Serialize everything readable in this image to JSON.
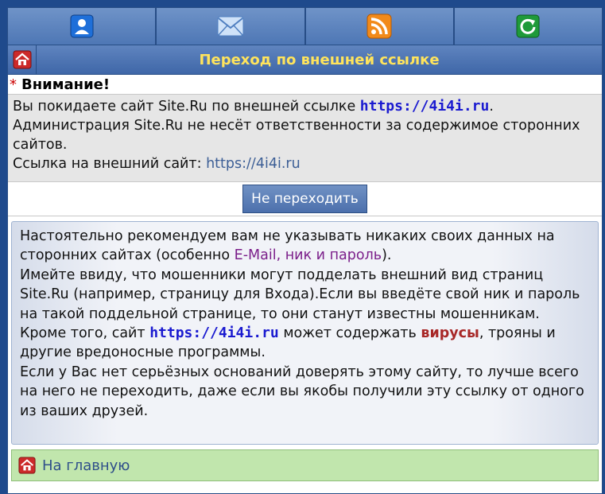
{
  "toolbar": {
    "items": [
      {
        "icon": "user-icon",
        "color": "#1e6fd9"
      },
      {
        "icon": "mail-icon",
        "color": "#9cc3ee"
      },
      {
        "icon": "rss-icon",
        "color": "#f28a1a"
      },
      {
        "icon": "refresh-icon",
        "color": "#1f9a3a"
      }
    ]
  },
  "header": {
    "title": "Переход по внешней ссылке",
    "title_color": "#ffe45c"
  },
  "attention": {
    "star": "*",
    "label": "Внимание!"
  },
  "info": {
    "line1_prefix": "Вы покидаете сайт Site.Ru по внешней ссылке ",
    "link_bold": "https://4i4i.ru",
    "line1_suffix": ".",
    "line2": "Администрация Site.Ru не несёт ответственности за содержимое сторонних сайтов.",
    "line3_prefix": "Ссылка на внешний сайт: ",
    "link_plain": "https://4i4i.ru"
  },
  "stay_button": {
    "label": "Не переходить"
  },
  "warning": {
    "p1_prefix": "Настоятельно рекомендуем вам не указывать никаких своих данных на сторонних сайтах (особенно ",
    "p1_highlight": "E-Mail, ник и пароль",
    "p1_suffix": ").",
    "p2": "Имейте ввиду, что мошенники могут подделать внешний вид страниц Site.Ru (например, страницу для Входа).Если вы введёте свой ник и пароль на такой поддельной странице, то они станут известны мошенникам.",
    "p3_prefix": "Кроме того, сайт ",
    "p3_link": "https://4i4i.ru",
    "p3_middle": " может содержать ",
    "p3_virus": "вирусы",
    "p3_suffix": ", трояны и другие вредоносные программы.",
    "p4": "Если у Вас нет серьёзных оснований доверять этому сайту, то лучше всего на него не переходить, даже если вы якобы получили эту ссылку от одного из ваших друзей."
  },
  "home": {
    "label": "На главную",
    "bg_color": "#c1e6ad"
  }
}
